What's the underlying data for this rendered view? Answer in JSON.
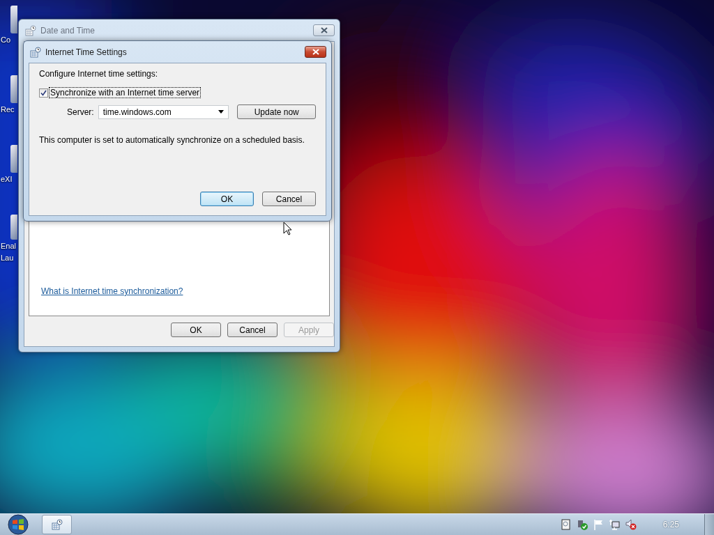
{
  "desktop": {
    "icons": [
      {
        "lines": [
          "Co"
        ]
      },
      {
        "lines": [
          "Rec"
        ]
      },
      {
        "lines": [
          "eXI"
        ]
      },
      {
        "lines": [
          "Enal",
          "Lau"
        ]
      }
    ]
  },
  "date_time_window": {
    "title": "Date and Time",
    "link": "What is Internet time synchronization?",
    "buttons": [
      {
        "label": "OK",
        "disabled": false
      },
      {
        "label": "Cancel",
        "disabled": false
      },
      {
        "label": "Apply",
        "disabled": true
      }
    ]
  },
  "internet_time_dialog": {
    "title": "Internet Time Settings",
    "heading": "Configure Internet time settings:",
    "sync": {
      "label": "Synchronize with an Internet time server",
      "checked": true
    },
    "server": {
      "label": "Server:",
      "value": "time.windows.com"
    },
    "update_button": "Update now",
    "status": "This computer is set to automatically synchronize on a scheduled basis.",
    "buttons": [
      {
        "label": "OK",
        "default": true
      },
      {
        "label": "Cancel",
        "default": false
      }
    ]
  },
  "taskbar": {
    "clock": "6:25"
  }
}
